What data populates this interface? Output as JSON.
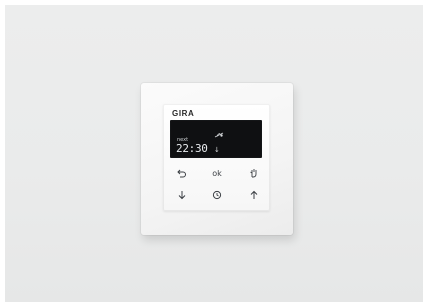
{
  "device": {
    "brand": "GIRA",
    "display": {
      "top_icon": "sun-moon-icon",
      "label": "next",
      "time": "22:30",
      "direction_symbol": "↓"
    },
    "keys": {
      "row1": [
        {
          "icon": "return-icon"
        },
        {
          "label": "ok"
        },
        {
          "icon": "hand-icon"
        }
      ],
      "row2": [
        {
          "icon": "arrow-down-icon"
        },
        {
          "icon": "clock-program-icon"
        },
        {
          "icon": "arrow-up-icon"
        }
      ]
    }
  },
  "colors": {
    "background": "#eaebeb",
    "frame": "#f5f5f5",
    "display": "#0f1012"
  }
}
